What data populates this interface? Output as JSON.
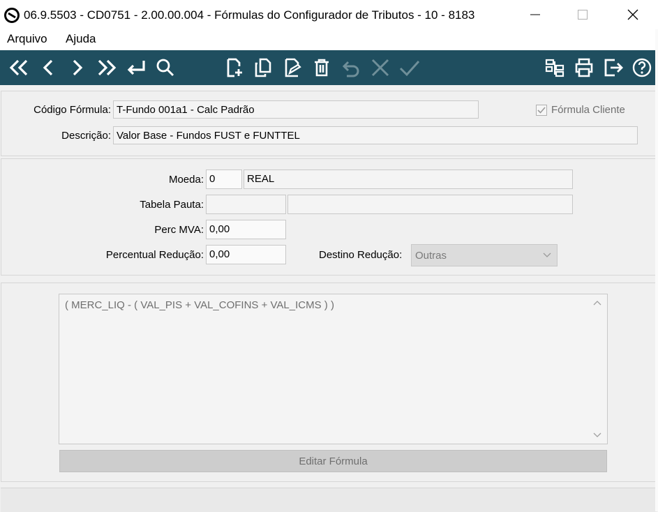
{
  "window": {
    "title": "06.9.5503 - CD0751 - 2.00.00.004 - Fórmulas do Configurador de Tributos - 10 - 8183"
  },
  "menu": [
    "Arquivo",
    "Ajuda"
  ],
  "toolbar": {
    "nav_icons": [
      "first-icon",
      "previous-icon",
      "next-icon",
      "last-icon",
      "goto-icon",
      "search-icon"
    ],
    "edit_icons": [
      "new-document-icon",
      "copy-document-icon",
      "edit-document-icon",
      "delete-icon",
      "undo-icon",
      "cancel-icon",
      "confirm-icon"
    ],
    "right_icons": [
      "structure-icon",
      "print-icon",
      "exit-icon",
      "help-icon"
    ]
  },
  "header": {
    "codigo_label": "Código Fórmula:",
    "codigo_value": "T-Fundo 001a1 - Calc Padrão",
    "formula_cliente_label": "Fórmula Cliente",
    "formula_cliente_checked": true,
    "descricao_label": "Descrição:",
    "descricao_value": "Valor Base - Fundos FUST e FUNTTEL"
  },
  "details": {
    "moeda_label": "Moeda:",
    "moeda_code": "0",
    "moeda_name": "REAL",
    "tabela_pauta_label": "Tabela Pauta:",
    "tabela_pauta_code": "",
    "tabela_pauta_desc": "",
    "perc_mva_label": "Perc MVA:",
    "perc_mva_value": "0,00",
    "perc_reducao_label": "Percentual Redução:",
    "perc_reducao_value": "0,00",
    "destino_reducao_label": "Destino Redução:",
    "destino_reducao_value": "Outras"
  },
  "formula": {
    "text": "( MERC_LIQ - ( VAL_PIS + VAL_COFINS + VAL_ICMS ) )",
    "edit_button": "Editar Fórmula"
  },
  "colors": {
    "toolbar_bg": "#1f4e5f",
    "toolbar_icon": "#ffffff",
    "toolbar_icon_disabled": "#6f8f99"
  }
}
